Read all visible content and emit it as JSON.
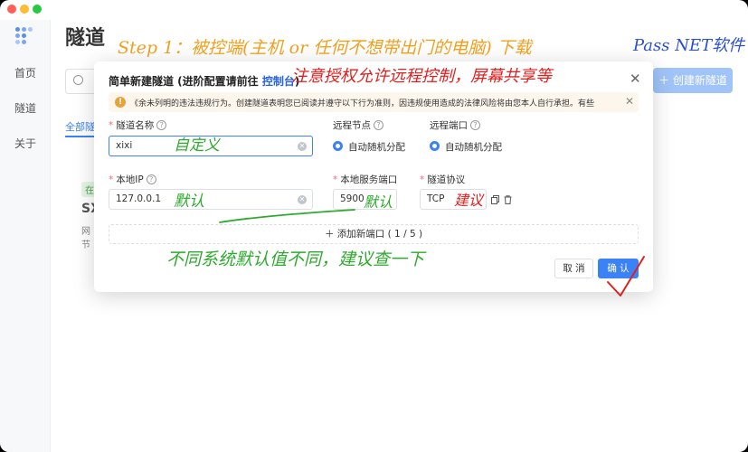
{
  "app": {
    "page_title": "隧道",
    "create_button": "创建新隧道",
    "tab_all": "全部隧道"
  },
  "sidebar": {
    "items": [
      {
        "label": "首页"
      },
      {
        "label": "隧道"
      },
      {
        "label": "关于"
      }
    ]
  },
  "card": {
    "tag": "在",
    "title": "SX",
    "line1": "网",
    "line2": "节"
  },
  "dialog": {
    "title_prefix": "简单新建隧道 (进阶配置请前往 ",
    "title_link": "控制台",
    "title_suffix": ")",
    "warning": "《余未列明的违法违规行为。创建隧道表明您已阅读并遵守以下行为准则，因违规使用造成的法律风险将由您本人自行承担。有些",
    "fields": {
      "tunnel_name_label": "隧道名称",
      "tunnel_name_value": "xixi",
      "remote_node_label": "远程节点",
      "remote_node_option": "自动随机分配",
      "remote_port_label": "远程端口",
      "remote_port_option": "自动随机分配",
      "local_ip_label": "本地IP",
      "local_ip_value": "127.0.0.1",
      "local_port_label": "本地服务端口",
      "local_port_value": "5900",
      "protocol_label": "隧道协议",
      "protocol_value": "TCP"
    },
    "add_port": "添加新端口 ( 1 / 5 )",
    "cancel": "取 消",
    "confirm": "确 认"
  },
  "annotations": {
    "line1": "Step 1：被控端(主机 or 任何不想带出门的电脑) 下载",
    "line1_brand": "Pass NET软件",
    "line2": "注意授权允许远程控制，屏幕共享等",
    "custom": "自定义",
    "default1": "默认",
    "default2": "默认",
    "suggest": "建议",
    "bottom": "不同系统默认值不同，建议查一下"
  },
  "colors": {
    "accent": "#3b82f6",
    "warning": "#e6a23c",
    "annot_orange": "#f0a020",
    "annot_blue": "#2a4fd0",
    "annot_red": "#e02020",
    "annot_green": "#2eaa2e"
  }
}
